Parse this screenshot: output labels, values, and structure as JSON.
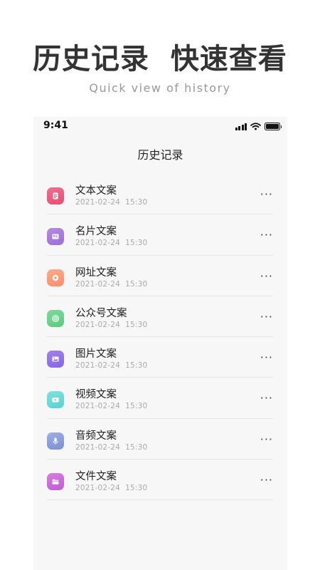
{
  "hero": {
    "title": "历史记录  快速查看",
    "subtitle": "Quick view of history"
  },
  "status_bar": {
    "time": "9:41"
  },
  "nav": {
    "title": "历史记录"
  },
  "items": [
    {
      "title": "文本文案",
      "time": "2021-02-24  15:30",
      "icon": "document-icon",
      "color_from": "#f06e8f",
      "color_to": "#e84e72"
    },
    {
      "title": "名片文案",
      "time": "2021-02-24  15:30",
      "icon": "card-icon",
      "color_from": "#b48ae0",
      "color_to": "#9a6fd6"
    },
    {
      "title": "网址文案",
      "time": "2021-02-24  15:30",
      "icon": "link-icon",
      "color_from": "#ffab88",
      "color_to": "#fb8d6c"
    },
    {
      "title": "公众号文案",
      "time": "2021-02-24  15:30",
      "icon": "target-icon",
      "color_from": "#7fd99a",
      "color_to": "#5cc97f"
    },
    {
      "title": "图片文案",
      "time": "2021-02-24  15:30",
      "icon": "image-icon",
      "color_from": "#a382ea",
      "color_to": "#8566df"
    },
    {
      "title": "视频文案",
      "time": "2021-02-24  15:30",
      "icon": "video-icon",
      "color_from": "#7fe2e0",
      "color_to": "#5cd0d2"
    },
    {
      "title": "音频文案",
      "time": "2021-02-24  15:30",
      "icon": "microphone-icon",
      "color_from": "#9eaee6",
      "color_to": "#7d8fd6"
    },
    {
      "title": "文件文案",
      "time": "2021-02-24  15:30",
      "icon": "folder-icon",
      "color_from": "#d77ee0",
      "color_to": "#bd5cd2"
    }
  ],
  "more_label": "···"
}
